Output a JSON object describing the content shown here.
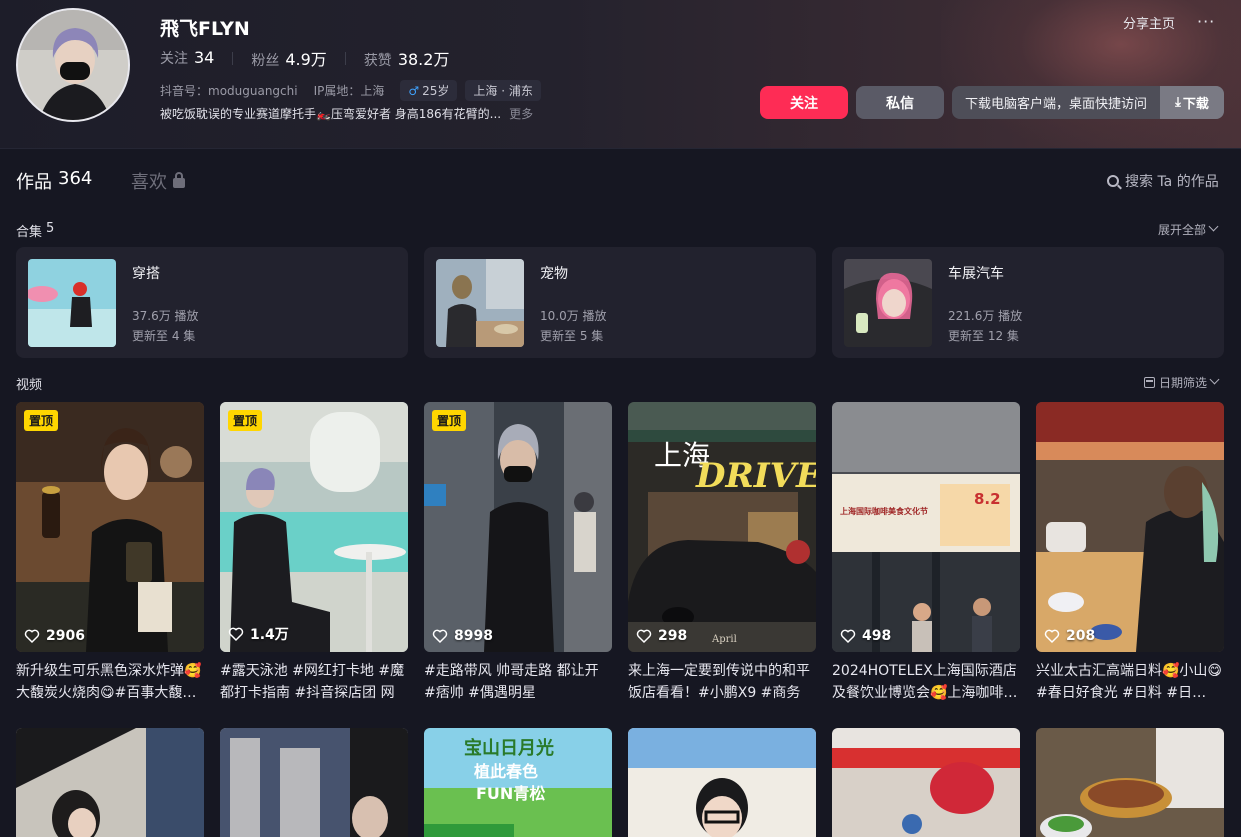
{
  "profile": {
    "nickname": "飛飞FLYN",
    "stats": {
      "following_label": "关注",
      "following": "34",
      "followers_label": "粉丝",
      "followers": "4.9万",
      "likes_label": "获赞",
      "likes": "38.2万"
    },
    "douyin_id": "抖音号：moduguangchi",
    "ip_location": "IP属地：上海",
    "age": "25岁",
    "district": "上海 · 浦东",
    "bio": "被吃饭耽误的专业赛道摩托手🏍️压弯爱好者 身高186有花臂的...",
    "more": "更多"
  },
  "actions": {
    "share": "分享主页",
    "more_dots": "···",
    "follow": "关注",
    "message": "私信",
    "download_prompt": "下载电脑客户端，桌面快捷访问",
    "download": "下载"
  },
  "tabs": {
    "works_label": "作品",
    "works_count": "364",
    "likes_label": "喜欢",
    "search": "搜索 Ta 的作品"
  },
  "collections": {
    "title": "合集",
    "count": "5",
    "expand": "展开全部",
    "items": [
      {
        "name": "穿搭",
        "plays": "37.6万 播放",
        "updated": "更新至 4 集"
      },
      {
        "name": "宠物",
        "plays": "10.0万 播放",
        "updated": "更新至 5 集"
      },
      {
        "name": "车展汽车",
        "plays": "221.6万 播放",
        "updated": "更新至 12 集"
      }
    ]
  },
  "videos": {
    "title": "视频",
    "date_filter": "日期筛选",
    "pin_label": "置顶",
    "items": [
      {
        "likes": "2906",
        "title": "新升级生可乐黑色深水炸弹🥰大馥炭火烧肉😋#百事大馥…",
        "pinned": true
      },
      {
        "likes": "1.4万",
        "title": "#露天泳池 #网红打卡地 #魔都打卡指南 #抖音探店团 网红…",
        "pinned": true
      },
      {
        "likes": "8998",
        "title": "#走路带风 帅哥走路 都让开 #痞帅 #偶遇明星",
        "pinned": true
      },
      {
        "likes": "298",
        "title": "来上海一定要到传说中的和平饭店看看！#小鹏X9 #商务 …",
        "pinned": false
      },
      {
        "likes": "498",
        "title": "2024HOTELEX上海国际酒店及餐饮业博览会🥰上海咖啡…",
        "pinned": false
      },
      {
        "likes": "208",
        "title": "兴业太古汇高端日料🥰小山😋#春日好食光 #日料 #日…",
        "pinned": false
      }
    ],
    "thumb_texts": {
      "v4_line1": "上海",
      "v4_line2": "DRIVE",
      "v4_sign": "April",
      "v5_banner": "上海国际咖啡美食文化节",
      "v5_date": "8.2",
      "r2_c3_line1": "宝山日月光",
      "r2_c3_line2": "植此春色",
      "r2_c3_line3": "FUN青松"
    }
  }
}
